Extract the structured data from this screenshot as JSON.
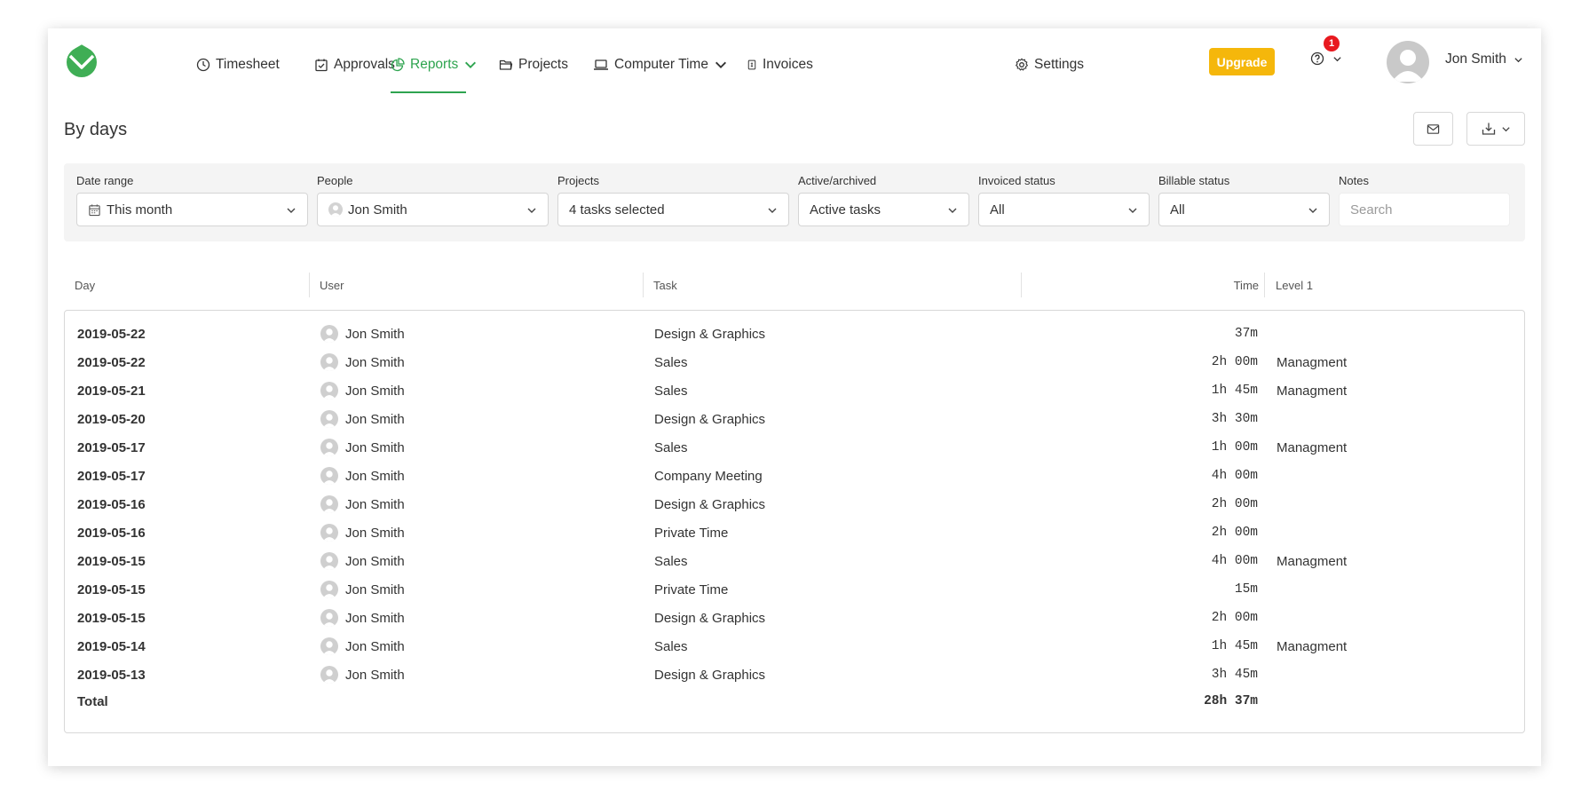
{
  "nav": {
    "items": [
      {
        "label": "Timesheet"
      },
      {
        "label": "Approvals"
      },
      {
        "label": "Reports"
      },
      {
        "label": "Projects"
      },
      {
        "label": "Computer Time"
      },
      {
        "label": "Invoices"
      }
    ],
    "settings_label": "Settings",
    "upgrade_label": "Upgrade",
    "notification_count": "1",
    "user_name": "Jon Smith"
  },
  "page": {
    "title": "By days"
  },
  "filters": {
    "date_range": {
      "label": "Date range",
      "value": "This month"
    },
    "people": {
      "label": "People",
      "value": "Jon Smith"
    },
    "projects": {
      "label": "Projects",
      "value": "4 tasks selected"
    },
    "active": {
      "label": "Active/archived",
      "value": "Active tasks"
    },
    "invoiced": {
      "label": "Invoiced status",
      "value": "All"
    },
    "billable": {
      "label": "Billable status",
      "value": "All"
    },
    "notes": {
      "label": "Notes",
      "placeholder": "Search"
    }
  },
  "table": {
    "headers": {
      "day": "Day",
      "user": "User",
      "task": "Task",
      "time": "Time",
      "level": "Level 1"
    },
    "rows": [
      {
        "day": "2019-05-22",
        "user": "Jon Smith",
        "task": "Design & Graphics",
        "time": "37m",
        "level": ""
      },
      {
        "day": "2019-05-22",
        "user": "Jon Smith",
        "task": "Sales",
        "time": "2h 00m",
        "level": "Managment"
      },
      {
        "day": "2019-05-21",
        "user": "Jon Smith",
        "task": "Sales",
        "time": "1h 45m",
        "level": "Managment"
      },
      {
        "day": "2019-05-20",
        "user": "Jon Smith",
        "task": "Design & Graphics",
        "time": "3h 30m",
        "level": ""
      },
      {
        "day": "2019-05-17",
        "user": "Jon Smith",
        "task": "Sales",
        "time": "1h 00m",
        "level": "Managment"
      },
      {
        "day": "2019-05-17",
        "user": "Jon Smith",
        "task": "Company Meeting",
        "time": "4h 00m",
        "level": ""
      },
      {
        "day": "2019-05-16",
        "user": "Jon Smith",
        "task": "Design & Graphics",
        "time": "2h 00m",
        "level": ""
      },
      {
        "day": "2019-05-16",
        "user": "Jon Smith",
        "task": "Private Time",
        "time": "2h 00m",
        "level": ""
      },
      {
        "day": "2019-05-15",
        "user": "Jon Smith",
        "task": "Sales",
        "time": "4h 00m",
        "level": "Managment"
      },
      {
        "day": "2019-05-15",
        "user": "Jon Smith",
        "task": "Private Time",
        "time": "15m",
        "level": ""
      },
      {
        "day": "2019-05-15",
        "user": "Jon Smith",
        "task": "Design & Graphics",
        "time": "2h 00m",
        "level": ""
      },
      {
        "day": "2019-05-14",
        "user": "Jon Smith",
        "task": "Sales",
        "time": "1h 45m",
        "level": "Managment"
      },
      {
        "day": "2019-05-13",
        "user": "Jon Smith",
        "task": "Design & Graphics",
        "time": "3h 45m",
        "level": ""
      }
    ],
    "total": {
      "label": "Total",
      "time": "28h 37m"
    }
  },
  "colors": {
    "accent": "#2ea44f",
    "upgrade": "#f5b70b",
    "badge": "#e8191f"
  }
}
